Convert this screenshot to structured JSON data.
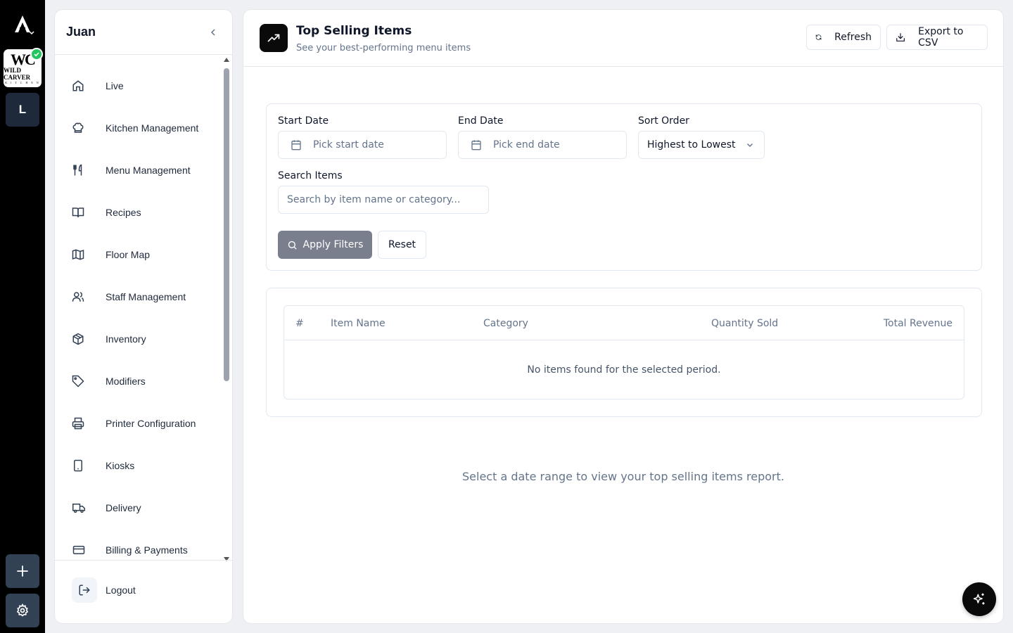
{
  "rail": {
    "logo_icon": "app-logo-icon",
    "restaurant_logo": {
      "monogram": "WC",
      "name": "WILD CARVER",
      "sub": "K I T C H E N"
    },
    "workspace_letter": "L"
  },
  "sidebar": {
    "title": "Juan",
    "items": [
      {
        "label": "Live",
        "icon": "home-icon"
      },
      {
        "label": "Kitchen Management",
        "icon": "chef-hat-icon"
      },
      {
        "label": "Menu Management",
        "icon": "utensils-icon"
      },
      {
        "label": "Recipes",
        "icon": "book-open-icon"
      },
      {
        "label": "Floor Map",
        "icon": "map-icon"
      },
      {
        "label": "Staff Management",
        "icon": "users-icon"
      },
      {
        "label": "Inventory",
        "icon": "package-icon"
      },
      {
        "label": "Modifiers",
        "icon": "tag-icon"
      },
      {
        "label": "Printer Configuration",
        "icon": "printer-icon"
      },
      {
        "label": "Kiosks",
        "icon": "tablet-icon"
      },
      {
        "label": "Delivery",
        "icon": "truck-icon"
      },
      {
        "label": "Billing & Payments",
        "icon": "credit-card-icon"
      }
    ],
    "logout_label": "Logout"
  },
  "header": {
    "title": "Top Selling Items",
    "subtitle": "See your best-performing menu items",
    "refresh_label": "Refresh",
    "export_label": "Export to CSV"
  },
  "filters": {
    "start_date_label": "Start Date",
    "start_date_placeholder": "Pick start date",
    "end_date_label": "End Date",
    "end_date_placeholder": "Pick end date",
    "sort_order_label": "Sort Order",
    "sort_order_value": "Highest to Lowest",
    "search_label": "Search Items",
    "search_placeholder": "Search by item name or category...",
    "apply_label": "Apply Filters",
    "reset_label": "Reset"
  },
  "table": {
    "columns": [
      "#",
      "Item Name",
      "Category",
      "Quantity Sold",
      "Total Revenue"
    ],
    "empty_message": "No items found for the selected period."
  },
  "hint": "Select a date range to view your top selling items report.",
  "colors": {
    "rail_bg": "#000000",
    "accent_dark": "#0a0a0a",
    "apply_button": "#6b7280",
    "verified_badge": "#22c55e"
  }
}
